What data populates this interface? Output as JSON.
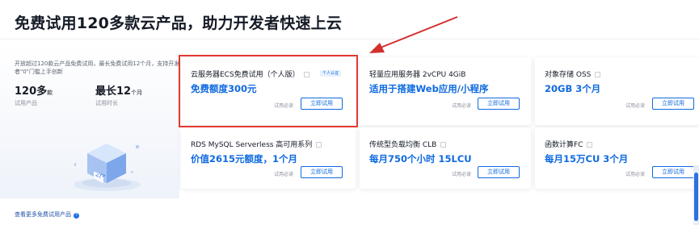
{
  "page": {
    "title": "免费试用120多款云产品，助力开发者快速上云"
  },
  "intro": {
    "description": "开放超过120款云产品免费试用，最长免费试用12个月，支持开发者\"0\"门槛上手创新",
    "stats": [
      {
        "value": "120多",
        "unit": "款",
        "label": "试用产品"
      },
      {
        "value": "最长12",
        "unit": "个月",
        "label": "试用时长"
      }
    ],
    "more_link": "查看更多免费试用产品"
  },
  "cards": [
    {
      "title": "云服务器ECS免费试用（个人版）",
      "badge": "个人认证",
      "price": "免费额度300元",
      "link": "试用必读",
      "button": "立即试用"
    },
    {
      "title": "轻量应用服务器 2vCPU 4GiB",
      "price": "适用于搭建Web应用/小程序",
      "link": "试用必读",
      "button": "立即试用"
    },
    {
      "title": "对象存储 OSS",
      "price": "20GB 3个月",
      "link": "试用必读",
      "button": "立即试用"
    },
    {
      "title": "RDS MySQL Serverless 高可用系列",
      "price": "价值2615元额度，1个月",
      "link": "试用必读",
      "button": "立即试用"
    },
    {
      "title": "传统型负载均衡 CLB",
      "price": "每月750个小时 15LCU",
      "link": "试用必读",
      "button": "立即试用"
    },
    {
      "title": "函数计算FC",
      "price": "每月15万CU 3个月",
      "link": "试用必读",
      "button": "立即试用"
    }
  ],
  "colors": {
    "accent": "#0f6ae0",
    "highlight": "#e53935",
    "arrow": "#d32f2f"
  },
  "icons": {
    "cube": "code-cube-icon",
    "info": "info-icon",
    "help": "help-circle-icon"
  }
}
